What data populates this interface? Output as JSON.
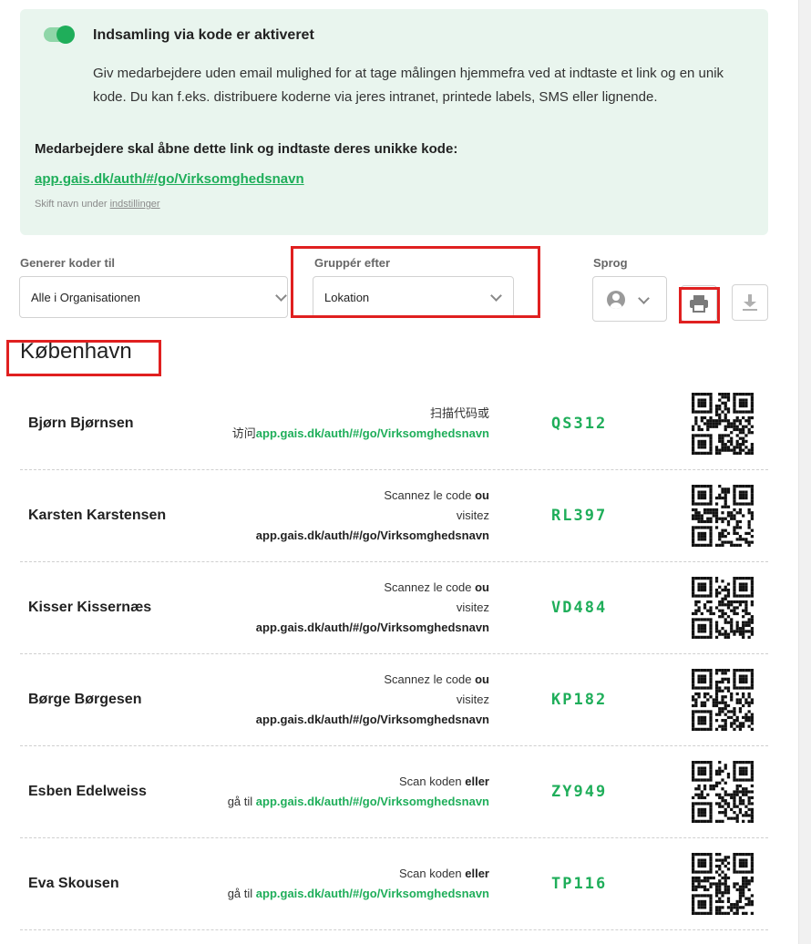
{
  "banner": {
    "toggle_on": true,
    "title": "Indsamling via kode er aktiveret",
    "description": "Giv medarbejdere uden email mulighed for at tage målingen hjemmefra ved at indtaste et link og en unik kode. Du kan f.eks. distribuere koderne via jeres intranet, printede labels, SMS eller lignende.",
    "instruction": "Medarbejdere skal åbne dette link og indtaste deres unikke kode:",
    "link": "app.gais.dk/auth/#/go/Virksomghedsnavn",
    "rename_prefix": "Skift navn under",
    "rename_link": "indstillinger"
  },
  "controls": {
    "generate_label": "Generer koder til",
    "generate_value": "Alle i Organisationen",
    "group_label": "Gruppér efter",
    "group_value": "Lokation",
    "language_label": "Sprog",
    "language_icon": "user-circle-icon",
    "print_icon": "printer-icon",
    "download_icon": "download-icon"
  },
  "group": {
    "heading": "København"
  },
  "rows": [
    {
      "name": "Bjørn Bjørnsen",
      "code": "QS312",
      "lines": [
        [
          {
            "t": "扫描代码或",
            "s": "n"
          }
        ],
        [
          {
            "t": "访问",
            "s": "n"
          },
          {
            "t": "app.gais.dk/auth/#/go/Virksomghedsnavn",
            "s": "g"
          }
        ]
      ]
    },
    {
      "name": "Karsten Karstensen",
      "code": "RL397",
      "lines": [
        [
          {
            "t": "Scannez le code ",
            "s": "n"
          },
          {
            "t": "ou",
            "s": "b"
          }
        ],
        [
          {
            "t": "visitez",
            "s": "n"
          }
        ],
        [
          {
            "t": "app.gais.dk/auth/#/go/Virksomghedsnavn",
            "s": "b"
          }
        ]
      ]
    },
    {
      "name": "Kisser Kissernæs",
      "code": "VD484",
      "lines": [
        [
          {
            "t": "Scannez le code ",
            "s": "n"
          },
          {
            "t": "ou",
            "s": "b"
          }
        ],
        [
          {
            "t": "visitez",
            "s": "n"
          }
        ],
        [
          {
            "t": "app.gais.dk/auth/#/go/Virksomghedsnavn",
            "s": "b"
          }
        ]
      ]
    },
    {
      "name": "Børge Børgesen",
      "code": "KP182",
      "lines": [
        [
          {
            "t": "Scannez le code ",
            "s": "n"
          },
          {
            "t": "ou",
            "s": "b"
          }
        ],
        [
          {
            "t": "visitez",
            "s": "n"
          }
        ],
        [
          {
            "t": "app.gais.dk/auth/#/go/Virksomghedsnavn",
            "s": "b"
          }
        ]
      ]
    },
    {
      "name": "Esben Edelweiss",
      "code": "ZY949",
      "lines": [
        [
          {
            "t": "Scan koden ",
            "s": "n"
          },
          {
            "t": "eller",
            "s": "b"
          }
        ],
        [
          {
            "t": "gå til ",
            "s": "n"
          },
          {
            "t": "app.gais.dk/auth/#/go/Virksomghedsnavn",
            "s": "g"
          }
        ]
      ]
    },
    {
      "name": "Eva Skousen",
      "code": "TP116",
      "lines": [
        [
          {
            "t": "Scan koden ",
            "s": "n"
          },
          {
            "t": "eller",
            "s": "b"
          }
        ],
        [
          {
            "t": "gå til ",
            "s": "n"
          },
          {
            "t": "app.gais.dk/auth/#/go/Virksomghedsnavn",
            "s": "g"
          }
        ]
      ]
    }
  ],
  "colors": {
    "accent": "#1fae5a",
    "banner_bg": "#e9f5ee",
    "highlight": "#e02020"
  }
}
